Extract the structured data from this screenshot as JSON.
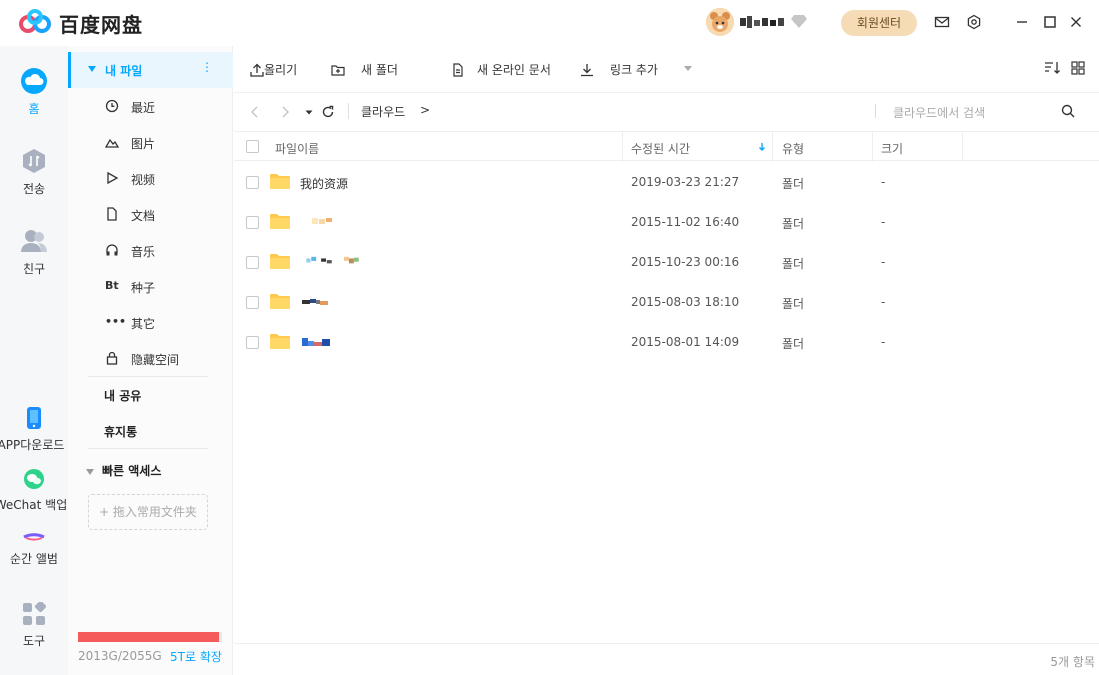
{
  "app": {
    "title": "百度网盘"
  },
  "titlebar": {
    "member_button": "회원센터",
    "icons": [
      "mail-icon",
      "settings-icon",
      "minimize-icon",
      "maximize-icon",
      "close-icon"
    ]
  },
  "rail": {
    "items": [
      {
        "label": "홈",
        "icon": "cloud-icon",
        "active": true
      },
      {
        "label": "전송",
        "icon": "transfer-icon"
      },
      {
        "label": "친구",
        "icon": "friends-icon"
      },
      {
        "label": "APP다운로드",
        "icon": "phone-icon"
      },
      {
        "label": "WeChat 백업",
        "icon": "wechat-icon"
      },
      {
        "label": "순간 앨범",
        "icon": "album-icon"
      },
      {
        "label": "도구",
        "icon": "tools-icon"
      }
    ]
  },
  "sidebar": {
    "my_files": "내 파일",
    "categories": [
      {
        "label": "最近",
        "icon": "clock-icon"
      },
      {
        "label": "图片",
        "icon": "image-icon"
      },
      {
        "label": "视频",
        "icon": "play-icon"
      },
      {
        "label": "文档",
        "icon": "document-icon"
      },
      {
        "label": "音乐",
        "icon": "headphones-icon"
      },
      {
        "label": "种子",
        "icon": "Bt"
      },
      {
        "label": "其它",
        "icon": "more-icon"
      },
      {
        "label": "隐藏空间",
        "icon": "lock-icon"
      }
    ],
    "my_share": "내 공유",
    "trash": "휴지통",
    "quick_access": "빠른 액세스",
    "drop_hint": "+ 拖入常用文件夹",
    "quota": {
      "text": "2013G/2055G",
      "used_fraction": 0.98,
      "upgrade": "5T로 확장"
    }
  },
  "toolbar": {
    "upload": "올리기",
    "new_folder": "새 폴더",
    "new_online_doc": "새 온라인 문서",
    "add_link": "링크 추가"
  },
  "nav": {
    "breadcrumb": "클라우드",
    "breadcrumb_sep": ">",
    "search_placeholder": "클라우드에서 검색"
  },
  "table": {
    "headers": {
      "name": "파일이름",
      "modified": "수정된 시간",
      "type": "유형",
      "size": "크기"
    },
    "rows": [
      {
        "name": "我的资源",
        "modified": "2019-03-23 21:27",
        "type": "폴더",
        "size": "-"
      },
      {
        "name": "",
        "modified": "2015-11-02 16:40",
        "type": "폴더",
        "size": "-"
      },
      {
        "name": "",
        "modified": "2015-10-23 00:16",
        "type": "폴더",
        "size": "-"
      },
      {
        "name": "",
        "modified": "2015-08-03 18:10",
        "type": "폴더",
        "size": "-"
      },
      {
        "name": "",
        "modified": "2015-08-01 14:09",
        "type": "폴더",
        "size": "-"
      }
    ]
  },
  "status": {
    "item_count": "5개 항목"
  },
  "colors": {
    "accent": "#06a7ff",
    "folder": "#ffc94d",
    "quota_bar": "#f45b5b",
    "member": "#f5dcb6"
  }
}
